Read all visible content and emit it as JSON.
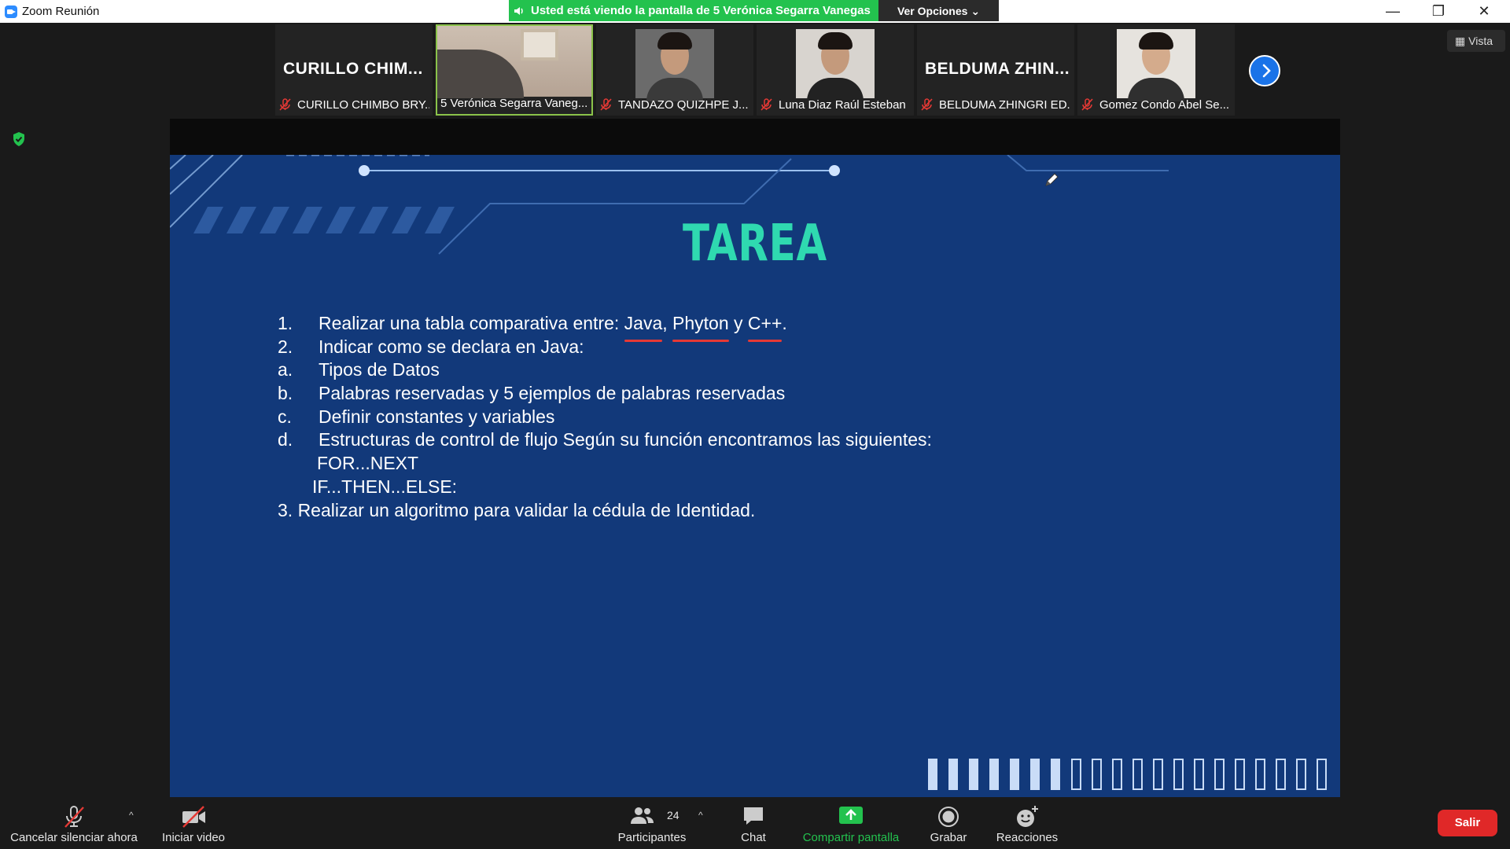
{
  "window": {
    "title": "Zoom Reunión",
    "share_banner": "Usted está viendo la pantalla de 5  Verónica Segarra Vanegas",
    "view_options": "Ver Opciones",
    "minimize": "—",
    "restore": "❐",
    "close": "✕"
  },
  "participants": [
    {
      "display": "CURILLO  CHIM...",
      "label": "CURILLO CHIMBO BRY...",
      "video": false,
      "muted": true
    },
    {
      "display": "",
      "label": "5  Verónica Segarra Vaneg...",
      "video": true,
      "muted": false,
      "active": true
    },
    {
      "display": "",
      "label": "TANDAZO QUIZHPE J...",
      "video": true,
      "muted": true
    },
    {
      "display": "",
      "label": "Luna Diaz Raúl Esteban",
      "video": true,
      "muted": true
    },
    {
      "display": "BELDUMA  ZHIN...",
      "label": "BELDUMA ZHINGRI ED...",
      "video": false,
      "muted": true
    },
    {
      "display": "",
      "label": "Gomez Condo Abel Se...",
      "video": true,
      "muted": true
    }
  ],
  "vista_label": "Vista",
  "slide": {
    "title": "TAREA",
    "line1_marker": "1.",
    "line1_prefix": "Realizar una tabla comparativa entre: ",
    "line1_java": "Java",
    "line1_comma": ", ",
    "line1_phyton": "Phyton",
    "line1_y": " y ",
    "line1_cpp": "C++",
    "line1_end": ".",
    "line2_marker": "2.",
    "line2": "Indicar como se declara en Java:",
    "linea_marker": "a.",
    "linea": "Tipos de Datos",
    "lineb_marker": "b.",
    "lineb": "Palabras reservadas y  5 ejemplos de palabras reservadas",
    "linec_marker": "c.",
    "linec": "Definir constantes y variables",
    "lined_marker": "d.",
    "lined": "Estructuras de control de flujo Según su función encontramos las siguientes:",
    "line_for": "FOR...NEXT",
    "line_if": "IF...THEN...ELSE:",
    "line3": "3. Realizar un algoritmo para validar la cédula de Identidad."
  },
  "toolbar": {
    "unmute": "Cancelar silenciar ahora",
    "start_video": "Iniciar video",
    "participants": "Participantes",
    "participant_count": "24",
    "chat": "Chat",
    "share": "Compartir pantalla",
    "record": "Grabar",
    "reactions": "Reacciones",
    "leave": "Salir"
  },
  "colors": {
    "share_green": "#23c24e",
    "slide_bg": "#12397a",
    "slide_title": "#2fd9b0",
    "leave_red": "#e02828",
    "link_blue": "#1a73e8"
  }
}
